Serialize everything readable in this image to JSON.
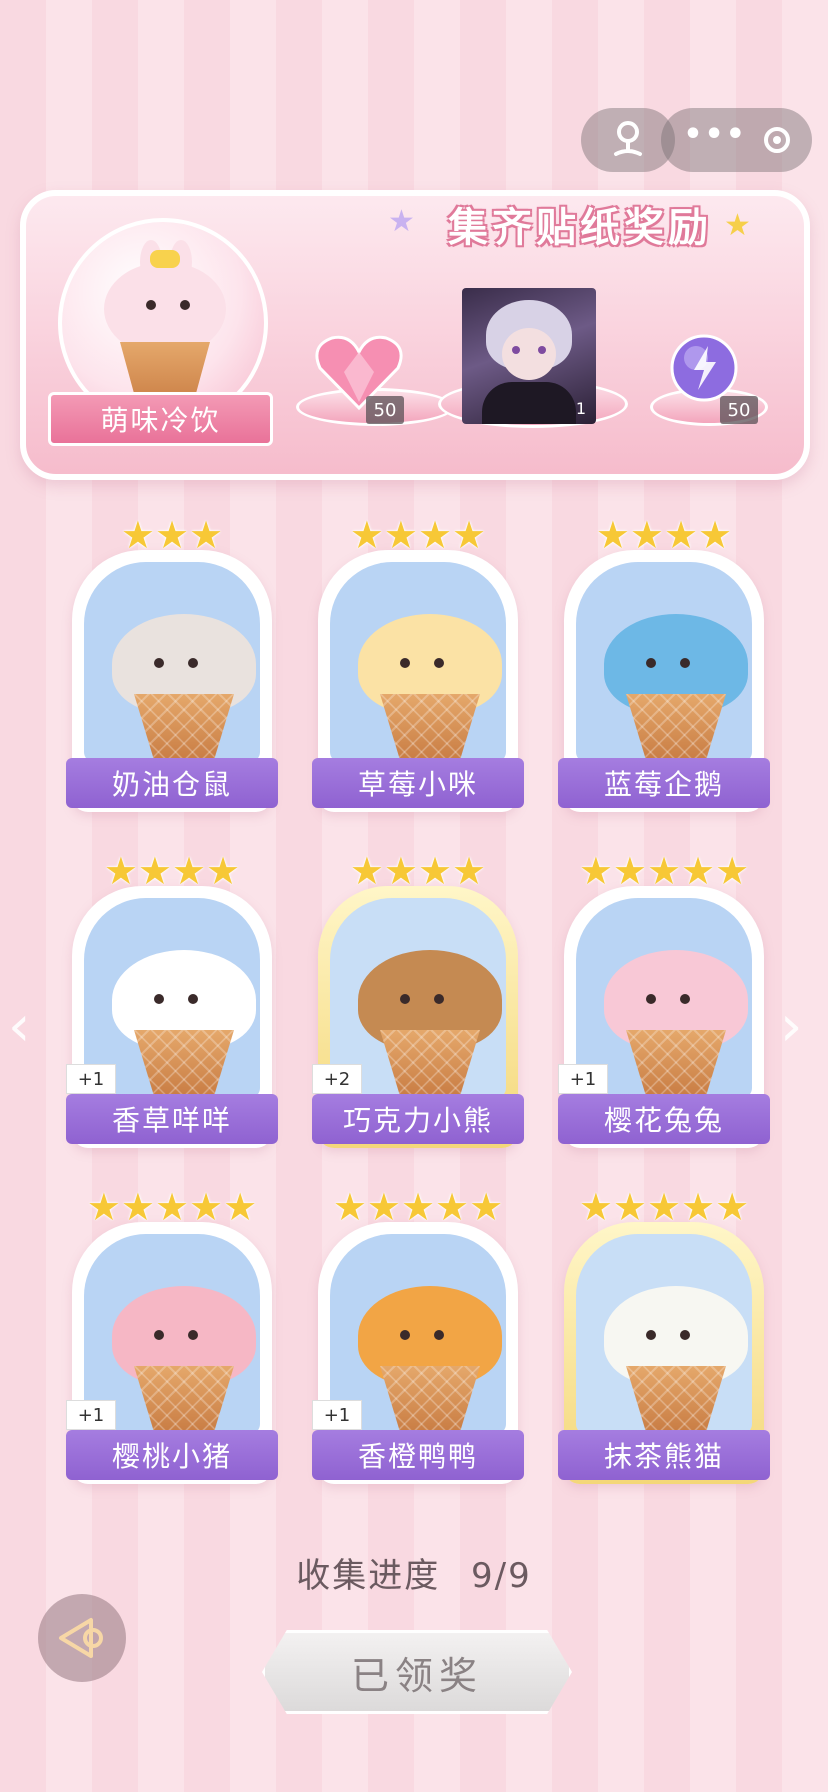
{
  "panel": {
    "title": "集齐贴纸奖励",
    "featured_name": "萌味冷饮",
    "rewards": [
      {
        "icon": "pink-heart-gem-icon",
        "count": "50"
      },
      {
        "icon": "character-portrait",
        "count": "1"
      },
      {
        "icon": "purple-lightning-orb-icon",
        "count": "50"
      }
    ]
  },
  "cards": [
    {
      "name": "奶油仓鼠",
      "stars": "★★★",
      "badge": "",
      "scoop_color": "#e9e2de",
      "gold": false
    },
    {
      "name": "草莓小咪",
      "stars": "★★★★",
      "badge": "",
      "scoop_color": "#fbe2a5",
      "gold": false
    },
    {
      "name": "蓝莓企鹅",
      "stars": "★★★★",
      "badge": "",
      "scoop_color": "#6db8e6",
      "gold": false
    },
    {
      "name": "香草咩咩",
      "stars": "★★★★",
      "badge": "+1",
      "scoop_color": "#ffffff",
      "gold": false
    },
    {
      "name": "巧克力小熊",
      "stars": "★★★★",
      "badge": "+2",
      "scoop_color": "#c58a52",
      "gold": true
    },
    {
      "name": "樱花兔兔",
      "stars": "★★★★★",
      "badge": "+1",
      "scoop_color": "#f8c8d6",
      "gold": false
    },
    {
      "name": "樱桃小猪",
      "stars": "★★★★★",
      "badge": "+1",
      "scoop_color": "#f6b7c5",
      "gold": false
    },
    {
      "name": "香橙鸭鸭",
      "stars": "★★★★★",
      "badge": "+1",
      "scoop_color": "#f2a545",
      "gold": false
    },
    {
      "name": "抹茶熊猫",
      "stars": "★★★★★",
      "badge": "",
      "scoop_color": "#f7f7f2",
      "gold": true
    }
  ],
  "progress": {
    "label": "收集进度",
    "value": "9/9"
  },
  "claim_button": {
    "label": "已领奖"
  },
  "nav": {
    "prev": "‹",
    "next": "›"
  }
}
